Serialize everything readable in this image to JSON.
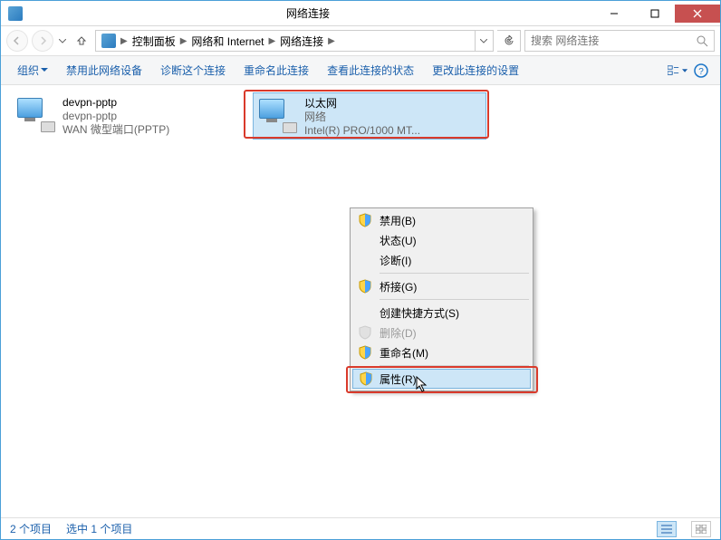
{
  "window": {
    "title": "网络连接"
  },
  "breadcrumb": {
    "seg1": "控制面板",
    "seg2": "网络和 Internet",
    "seg3": "网络连接"
  },
  "search": {
    "placeholder": "搜索 网络连接"
  },
  "toolbar": {
    "organize": "组织",
    "disable": "禁用此网络设备",
    "diagnose": "诊断这个连接",
    "rename": "重命名此连接",
    "viewstatus": "查看此连接的状态",
    "changesettings": "更改此连接的设置"
  },
  "items": [
    {
      "name": "devpn-pptp",
      "line2": "devpn-pptp",
      "line3": "WAN 微型端口(PPTP)"
    },
    {
      "name": "以太网",
      "line2": "网络",
      "line3": "Intel(R) PRO/1000 MT..."
    }
  ],
  "contextmenu": {
    "disable": "禁用(B)",
    "status": "状态(U)",
    "diagnose": "诊断(I)",
    "bridge": "桥接(G)",
    "shortcut": "创建快捷方式(S)",
    "delete": "删除(D)",
    "rename": "重命名(M)",
    "properties": "属性(R)"
  },
  "statusbar": {
    "count": "2 个项目",
    "selected": "选中 1 个项目"
  }
}
